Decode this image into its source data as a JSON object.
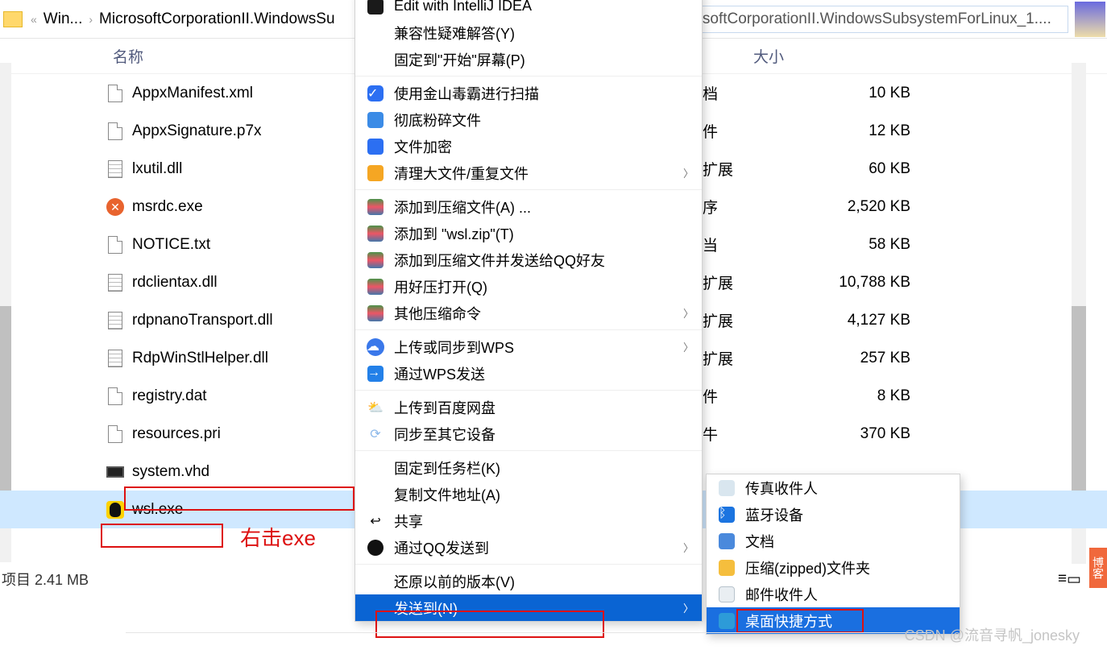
{
  "breadcrumb": {
    "chev": "«",
    "seg1": "Win...",
    "sep": "›",
    "seg2": "MicrosoftCorporationII.WindowsSu"
  },
  "search": {
    "placeholder": "rosoftCorporationII.WindowsSubsystemForLinux_1...."
  },
  "columns": {
    "name": "名称",
    "size": "大小"
  },
  "files": [
    {
      "name": "AppxManifest.xml",
      "type": "档",
      "size": "10 KB",
      "icon": "i-doc"
    },
    {
      "name": "AppxSignature.p7x",
      "type": "件",
      "size": "12 KB",
      "icon": "i-doc"
    },
    {
      "name": "lxutil.dll",
      "type": "扩展",
      "size": "60 KB",
      "icon": "i-dll"
    },
    {
      "name": "msrdc.exe",
      "type": "序",
      "size": "2,520 KB",
      "icon": "i-msrdc"
    },
    {
      "name": "NOTICE.txt",
      "type": "当",
      "size": "58 KB",
      "icon": "i-doc"
    },
    {
      "name": "rdclientax.dll",
      "type": "扩展",
      "size": "10,788 KB",
      "icon": "i-dll"
    },
    {
      "name": "rdpnanoTransport.dll",
      "type": "扩展",
      "size": "4,127 KB",
      "icon": "i-dll"
    },
    {
      "name": "RdpWinStlHelper.dll",
      "type": "扩展",
      "size": "257 KB",
      "icon": "i-dll"
    },
    {
      "name": "registry.dat",
      "type": "件",
      "size": "8 KB",
      "icon": "i-doc"
    },
    {
      "name": "resources.pri",
      "type": "牛",
      "size": "370 KB",
      "icon": "i-doc"
    },
    {
      "name": "system.vhd",
      "type": "",
      "size": "",
      "icon": "i-vhd"
    },
    {
      "name": "wsl.exe",
      "type": "",
      "size": "",
      "icon": "i-penguin",
      "selected": true
    }
  ],
  "menu": {
    "ij": "Edit with IntelliJ IDEA",
    "compat": "兼容性疑难解答(Y)",
    "pin_start": "固定到\"开始\"屏幕(P)",
    "scan": "使用金山毒霸进行扫描",
    "shred": "彻底粉碎文件",
    "encrypt": "文件加密",
    "clean": "清理大文件/重复文件",
    "zip_a": "添加到压缩文件(A) ...",
    "zip_t": "添加到 \"wsl.zip\"(T)",
    "zip_qq": "添加到压缩文件并发送给QQ好友",
    "zip_open": "用好压打开(Q)",
    "zip_other": "其他压缩命令",
    "wps_up": "上传或同步到WPS",
    "wps_send": "通过WPS发送",
    "baidu": "上传到百度网盘",
    "sync": "同步至其它设备",
    "pin_task": "固定到任务栏(K)",
    "copy_path": "复制文件地址(A)",
    "share": "共享",
    "qq_send": "通过QQ发送到",
    "restore": "还原以前的版本(V)",
    "send_to": "发送到(N)"
  },
  "submenu": {
    "fax": "传真收件人",
    "bt": "蓝牙设备",
    "doc": "文档",
    "zip": "压缩(zipped)文件夹",
    "mail": "邮件收件人",
    "desktop": "桌面快捷方式"
  },
  "annot": {
    "rightclick": "右击exe"
  },
  "status": {
    "items": "项目  2.41 MB"
  },
  "sidetab": "博客",
  "watermark": "CSDN @流音寻帆_jonesky"
}
